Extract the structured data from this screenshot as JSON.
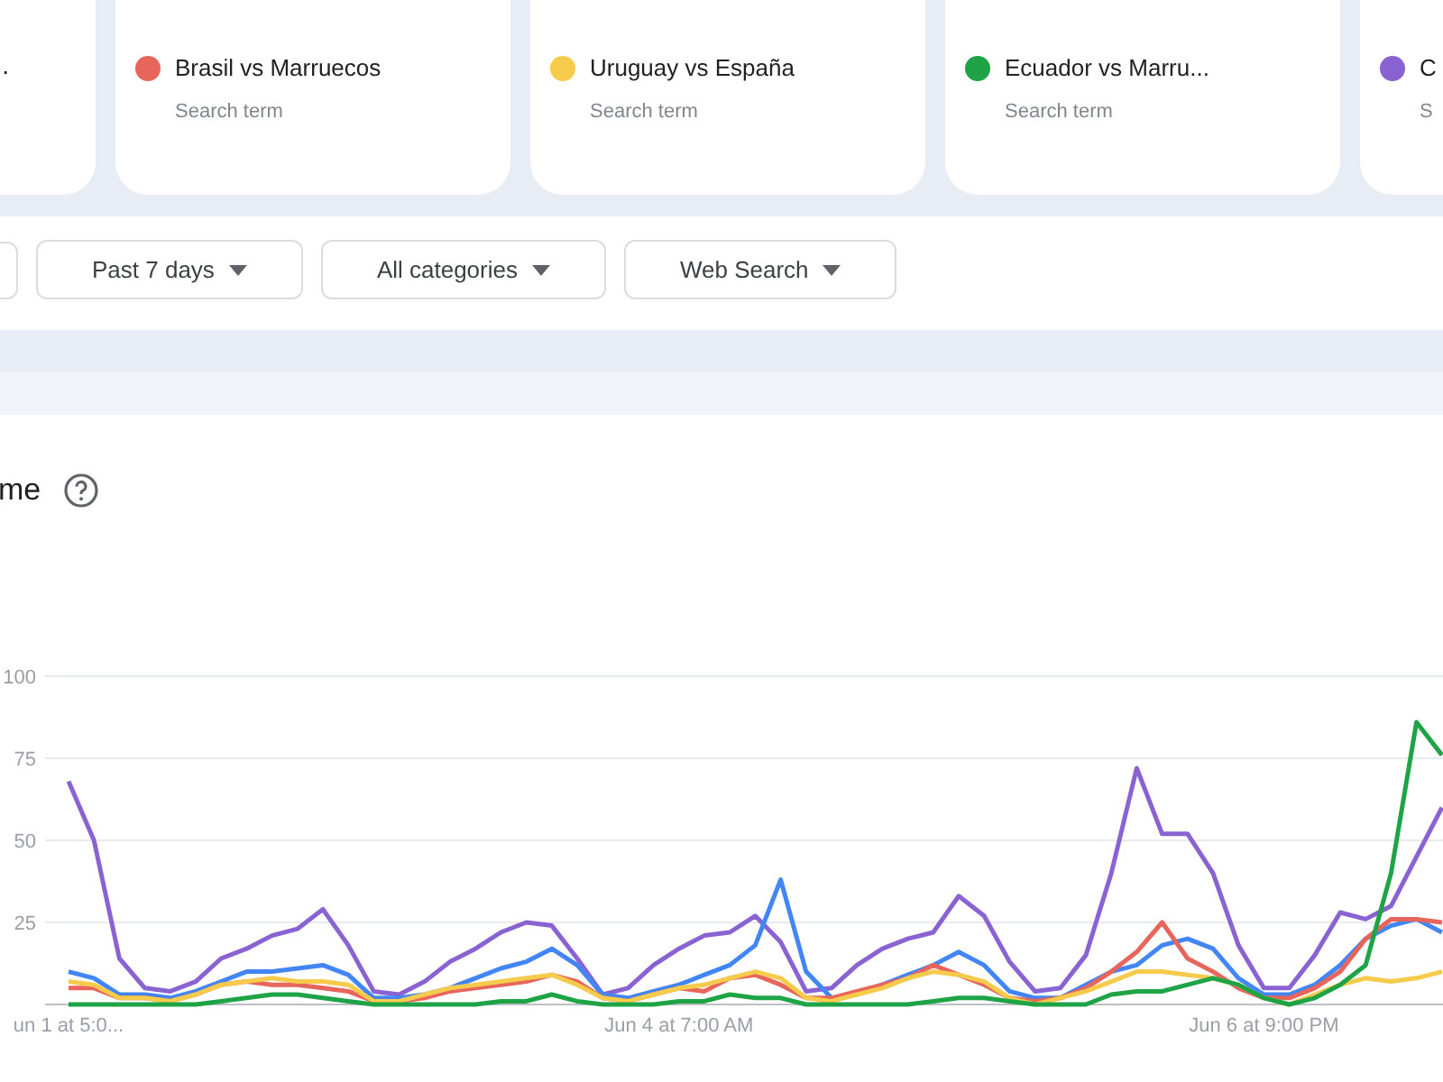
{
  "cards": [
    {
      "kind": "clipped",
      "title": "."
    },
    {
      "kind": "term",
      "title": "Brasil vs Marruecos",
      "subtitle": "Search term",
      "color": "#e8655b"
    },
    {
      "kind": "term",
      "title": "Uruguay vs España",
      "subtitle": "Search term",
      "color": "#f6cb4c"
    },
    {
      "kind": "term",
      "title": "Ecuador vs Marru...",
      "subtitle": "Search term",
      "color": "#1ea446"
    },
    {
      "kind": "term",
      "title": "C",
      "subtitle": "S",
      "color": "#8a63d2"
    }
  ],
  "filters": [
    {
      "kind": "clipped"
    },
    {
      "kind": "dropdown",
      "label": "Past 7 days"
    },
    {
      "kind": "dropdown",
      "label": "All categories"
    },
    {
      "kind": "dropdown",
      "label": "Web Search"
    }
  ],
  "section_title": "me",
  "chart": {
    "chart_data": {
      "type": "line",
      "categories": [
        "un 1 at 5:0...",
        null,
        null,
        null,
        null,
        null,
        null,
        null,
        null,
        null,
        null,
        null,
        null,
        null,
        null,
        null,
        null,
        null,
        null,
        null,
        null,
        null,
        null,
        null,
        "Jun 4 at 7:00 AM",
        null,
        null,
        null,
        null,
        null,
        null,
        null,
        null,
        null,
        null,
        null,
        null,
        null,
        null,
        null,
        null,
        null,
        null,
        null,
        null,
        null,
        null,
        "Jun 6 at 9:00 PM",
        null,
        null,
        null,
        null,
        null,
        null,
        null
      ],
      "yticks": [
        25,
        50,
        75,
        100
      ],
      "ylim": [
        0,
        100
      ],
      "grid": true,
      "series": [
        {
          "color": "#8a63d2",
          "values": [
            68,
            50,
            14,
            5,
            4,
            7,
            14,
            17,
            21,
            23,
            29,
            18,
            4,
            3,
            7,
            13,
            17,
            22,
            25,
            24,
            14,
            3,
            5,
            12,
            17,
            21,
            22,
            27,
            19,
            4,
            5,
            12,
            17,
            20,
            22,
            33,
            27,
            13,
            4,
            5,
            15,
            40,
            72,
            52,
            52,
            40,
            18,
            5,
            5,
            15,
            28,
            26,
            30,
            45,
            60
          ]
        },
        {
          "color": "#4285f4",
          "values": [
            10,
            8,
            3,
            3,
            2,
            4,
            7,
            10,
            10,
            11,
            12,
            9,
            2,
            2,
            3,
            5,
            8,
            11,
            13,
            17,
            12,
            3,
            2,
            4,
            6,
            9,
            12,
            18,
            38,
            10,
            2,
            3,
            6,
            9,
            12,
            16,
            12,
            4,
            2,
            2,
            6,
            10,
            12,
            18,
            20,
            17,
            8,
            3,
            3,
            6,
            12,
            20,
            24,
            26,
            22
          ]
        },
        {
          "color": "#e8655b",
          "values": [
            5,
            5,
            2,
            2,
            1,
            3,
            6,
            7,
            6,
            6,
            5,
            4,
            1,
            1,
            2,
            4,
            5,
            6,
            7,
            9,
            7,
            2,
            1,
            3,
            5,
            4,
            8,
            9,
            6,
            2,
            2,
            4,
            6,
            8,
            12,
            9,
            6,
            2,
            1,
            2,
            5,
            10,
            16,
            25,
            14,
            10,
            5,
            2,
            2,
            5,
            10,
            20,
            26,
            26,
            25
          ]
        },
        {
          "color": "#f6cb4c",
          "values": [
            7,
            6,
            2,
            2,
            1,
            3,
            6,
            7,
            8,
            7,
            7,
            6,
            1,
            1,
            3,
            5,
            6,
            7,
            8,
            9,
            6,
            2,
            1,
            3,
            5,
            6,
            8,
            10,
            8,
            2,
            1,
            3,
            5,
            8,
            10,
            9,
            7,
            2,
            0,
            2,
            4,
            7,
            10,
            10,
            9,
            8,
            6,
            2,
            0,
            3,
            6,
            8,
            7,
            8,
            10
          ]
        },
        {
          "color": "#1ea446",
          "values": [
            0,
            0,
            0,
            0,
            0,
            0,
            1,
            2,
            3,
            3,
            2,
            1,
            0,
            0,
            0,
            0,
            0,
            1,
            1,
            3,
            1,
            0,
            0,
            0,
            1,
            1,
            3,
            2,
            2,
            0,
            0,
            0,
            0,
            0,
            1,
            2,
            2,
            1,
            0,
            0,
            0,
            3,
            4,
            4,
            6,
            8,
            6,
            2,
            0,
            2,
            6,
            12,
            40,
            86,
            76
          ]
        }
      ]
    }
  }
}
